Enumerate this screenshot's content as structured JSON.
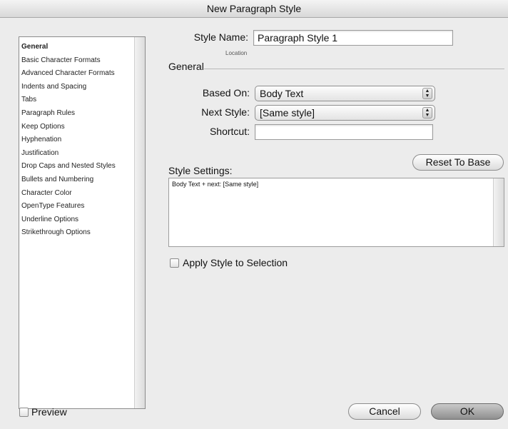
{
  "window": {
    "title": "New Paragraph Style"
  },
  "sidebar": {
    "items": [
      {
        "label": "General",
        "selected": true
      },
      {
        "label": "Basic Character Formats"
      },
      {
        "label": "Advanced Character Formats"
      },
      {
        "label": "Indents and Spacing"
      },
      {
        "label": "Tabs"
      },
      {
        "label": "Paragraph Rules"
      },
      {
        "label": "Keep Options"
      },
      {
        "label": "Hyphenation"
      },
      {
        "label": "Justification"
      },
      {
        "label": "Drop Caps and Nested Styles"
      },
      {
        "label": "Bullets and Numbering"
      },
      {
        "label": "Character Color"
      },
      {
        "label": "OpenType Features"
      },
      {
        "label": "Underline Options"
      },
      {
        "label": "Strikethrough Options"
      }
    ]
  },
  "form": {
    "style_name_label": "Style Name:",
    "style_name_value": "Paragraph Style 1",
    "location_label": "Location",
    "section_title": "General",
    "based_on_label": "Based On:",
    "based_on_value": "Body Text",
    "next_style_label": "Next Style:",
    "next_style_value": "[Same style]",
    "shortcut_label": "Shortcut:",
    "shortcut_value": "",
    "style_settings_label": "Style Settings:",
    "reset_button": "Reset To Base",
    "style_settings_text": "Body Text + next: [Same style]",
    "apply_style_label": "Apply Style to Selection",
    "apply_style_checked": false
  },
  "footer": {
    "preview_label": "Preview",
    "preview_checked": false,
    "cancel_button": "Cancel",
    "ok_button": "OK"
  }
}
